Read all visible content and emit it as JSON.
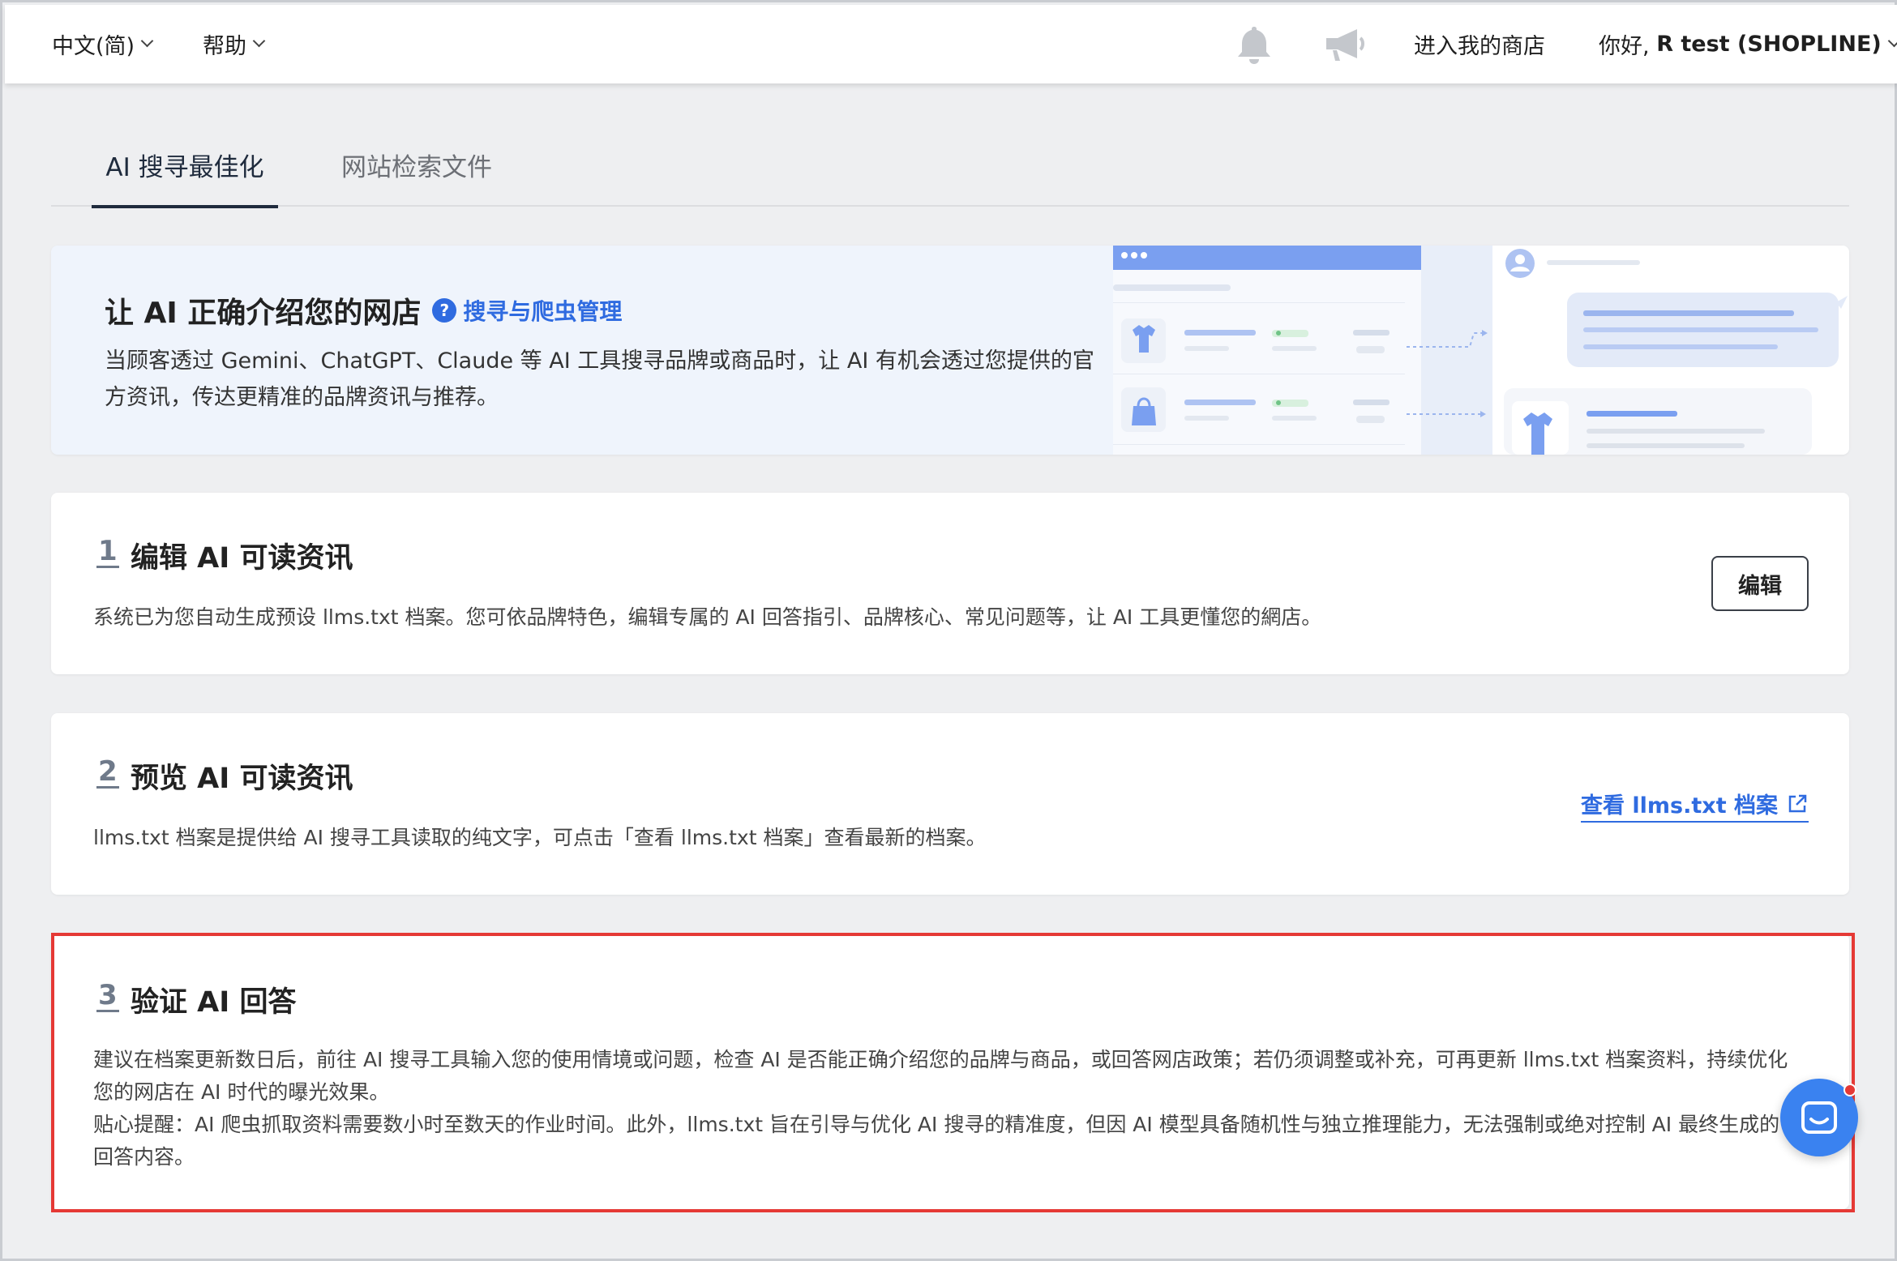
{
  "topbar": {
    "language": "中文(简)",
    "help": "帮助",
    "enter_store": "进入我的商店",
    "greeting": "你好,",
    "user_name": "R test (SHOPLINE)"
  },
  "tabs": [
    {
      "label": "AI 搜寻最佳化",
      "active": true
    },
    {
      "label": "网站检索文件",
      "active": false
    }
  ],
  "banner": {
    "title": "让 AI 正确介绍您的网店",
    "help_link": "搜寻与爬虫管理",
    "description": "当顾客透过 Gemini、ChatGPT、Claude 等 AI 工具搜寻品牌或商品时，让 AI 有机会透过您提供的官方资讯，传达更精准的品牌资讯与推荐。"
  },
  "steps": [
    {
      "number": "1",
      "title": "编辑 AI 可读资讯",
      "description": "系统已为您自动生成预设 llms.txt 档案。您可依品牌特色，编辑专属的 AI 回答指引、品牌核心、常见问题等，让 AI 工具更懂您的網店。",
      "action": "编辑"
    },
    {
      "number": "2",
      "title": "预览 AI 可读资讯",
      "description": "llms.txt 档案是提供给 AI 搜寻工具读取的纯文字，可点击「查看 llms.txt 档案」查看最新的档案。",
      "action": "查看 llms.txt 档案"
    },
    {
      "number": "3",
      "title": "验证 AI 回答",
      "description": "建议在档案更新数日后，前往 AI 搜寻工具输入您的使用情境或问题，检查 AI 是否能正确介绍您的品牌与商品，或回答网店政策；若仍须调整或补充，可再更新 llms.txt 档案资料，持续优化您的网店在 AI 时代的曝光效果。",
      "tip": "贴心提醒：AI 爬虫抓取资料需要数小时至数天的作业时间。此外，llms.txt 旨在引导与优化 AI 搜寻的精准度，但因 AI 模型具备随机性与独立推理能力，无法强制或绝对控制 AI 最终生成的回答内容。"
    }
  ],
  "colors": {
    "accent": "#2f6be0",
    "highlight": "#e53935",
    "chat": "#3a82f0"
  }
}
